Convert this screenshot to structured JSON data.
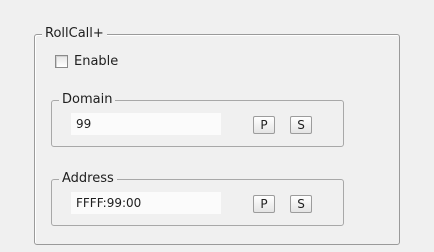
{
  "rollcall": {
    "title": "RollCall+",
    "enable": {
      "label": "Enable",
      "checked": false
    },
    "domain": {
      "title": "Domain",
      "value": "99",
      "p_label": "P",
      "s_label": "S"
    },
    "address": {
      "title": "Address",
      "value": "FFFF:99:00",
      "p_label": "P",
      "s_label": "S"
    }
  },
  "colors": {
    "background": "#f0f0f0",
    "border": "#a8a8a8",
    "field_background": "#fbfbfb"
  }
}
